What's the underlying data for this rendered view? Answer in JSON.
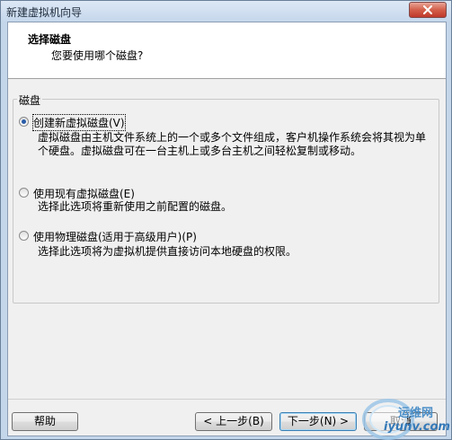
{
  "window": {
    "title": "新建虚拟机向导"
  },
  "header": {
    "title": "选择磁盘",
    "subtitle": "您要使用哪个磁盘?"
  },
  "group": {
    "label": "磁盘"
  },
  "options": [
    {
      "label": "创建新虚拟磁盘(V)",
      "description": "虚拟磁盘由主机文件系统上的一个或多个文件组成，客户机操作系统会将其视为单个硬盘。虚拟磁盘可在一台主机上或多台主机之间轻松复制或移动。",
      "checked": true
    },
    {
      "label": "使用现有虚拟磁盘(E)",
      "description": "选择此选项将重新使用之前配置的磁盘。",
      "checked": false
    },
    {
      "label": "使用物理磁盘(适用于高级用户)(P)",
      "description": "选择此选项将为虚拟机提供直接访问本地硬盘的权限。",
      "checked": false
    }
  ],
  "buttons": {
    "help": "帮助",
    "back": "< 上一步(B)",
    "next": "下一步(N) >",
    "cancel": "取消"
  },
  "watermark": {
    "top": "运维网",
    "bottom": "iyunv.com"
  },
  "colors": {
    "frame": "#c4d6ea",
    "close_button": "#c0392b",
    "client_bg": "#f0f0f0",
    "radio_dot": "#2a5ca8",
    "default_button_border": "#3c7fb1",
    "watermark": "#3479b8"
  }
}
